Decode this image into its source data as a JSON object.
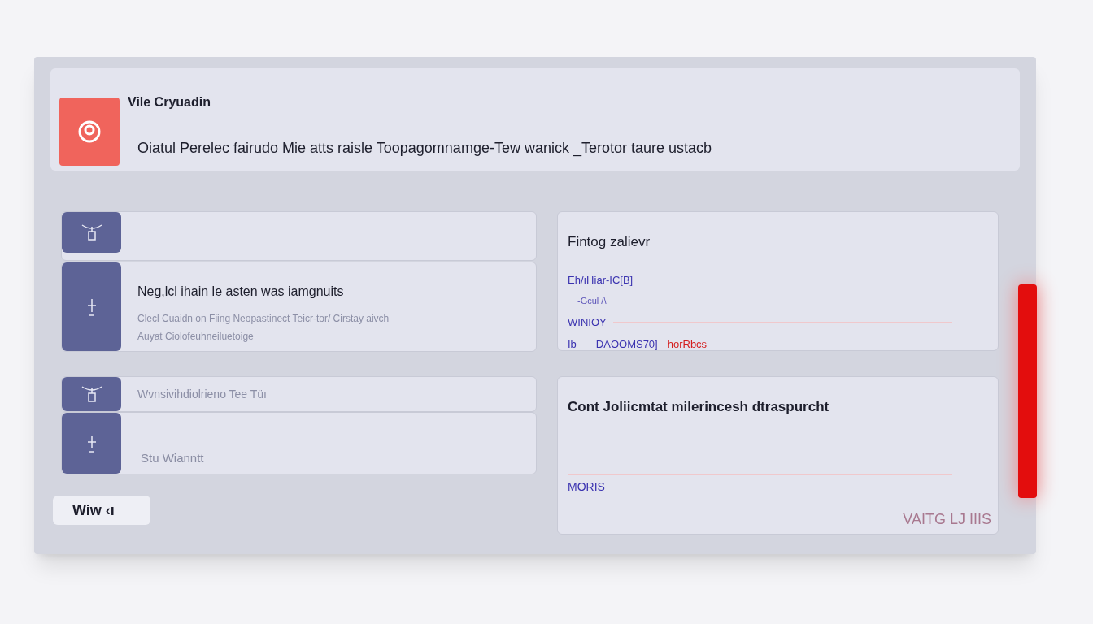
{
  "header": {
    "title": "Vile Cryuadin",
    "subtitle": "Oiatul Perelec fairudo Mie atts raisle Toopagomnamge-Tew wanick _Terotor taure ustacb"
  },
  "list_items": [
    {
      "title": "Neg,lcl ihain le asten was iamgnuits",
      "lines": [
        "Clecl  Cuaidn on Fiing Neopastinect Teicr-tor/ Cirstay aivch",
        "Auyat Ciolofeuhneiluetoige"
      ]
    },
    {
      "lines": [
        "Wvnsivihdiolrieno Tee Tüı"
      ]
    },
    {
      "lines": [
        "Stu Wianntt"
      ]
    }
  ],
  "button": "Wiw ‹ı",
  "summary_card": {
    "title": "Fintog zalievr",
    "rows": [
      {
        "kind": "label",
        "text": "Eh/ıHiar-IC[B]"
      },
      {
        "kind": "note",
        "text": "-Gcul /\\"
      },
      {
        "kind": "label",
        "text": "WINIOY"
      },
      {
        "kind": "pair",
        "text": "Ib",
        "code": "DAOOMS70]",
        "flag": "horRbcs"
      }
    ]
  },
  "contact_card": {
    "title": "Cont Joliicmtat milerincesh dtraspurcht",
    "tag": "MORIS",
    "footer": "VAITG LJ IIIS"
  }
}
